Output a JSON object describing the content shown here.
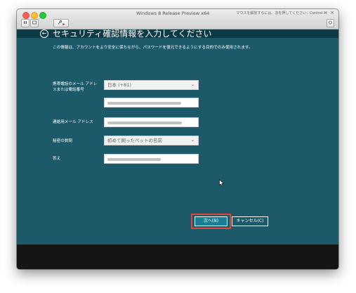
{
  "window": {
    "title": "Windows 8 Release Preview x64",
    "mouse_hint": "マウスを解放するには、次を押してください：Control-⌘",
    "hint_close": "×"
  },
  "toolbar": {
    "pause_icon": "pause-icon",
    "snapshot_icon": "snapshot-icon",
    "tools_icon": "wrench-icon",
    "tools_arrow": "▸",
    "right_icon": "resize-icon"
  },
  "form": {
    "back_icon": "back-arrow-icon",
    "back_glyph": "←",
    "heading": "セキュリティ確認情報を入力してください",
    "description": "この情報は、アカウントをより安全に保ちながら、パスワードを復元できるようにする目的でのみ使用されます。",
    "phone_label_line1": "携帯電話のメール アドレ",
    "phone_label_line2": "スまたは電話番号",
    "country_value": "日本 (+81)",
    "contact_email_label": "連絡用メール アドレス",
    "secret_question_label": "秘密の質問",
    "secret_question_value": "初めて飼ったペットの名前",
    "answer_label": "答え"
  },
  "buttons": {
    "next_label": "次へ(N)",
    "cancel_label": "キャンセル(C)"
  },
  "colors": {
    "screen_bg": "#1c5a6a",
    "highlight": "#e0453a"
  }
}
